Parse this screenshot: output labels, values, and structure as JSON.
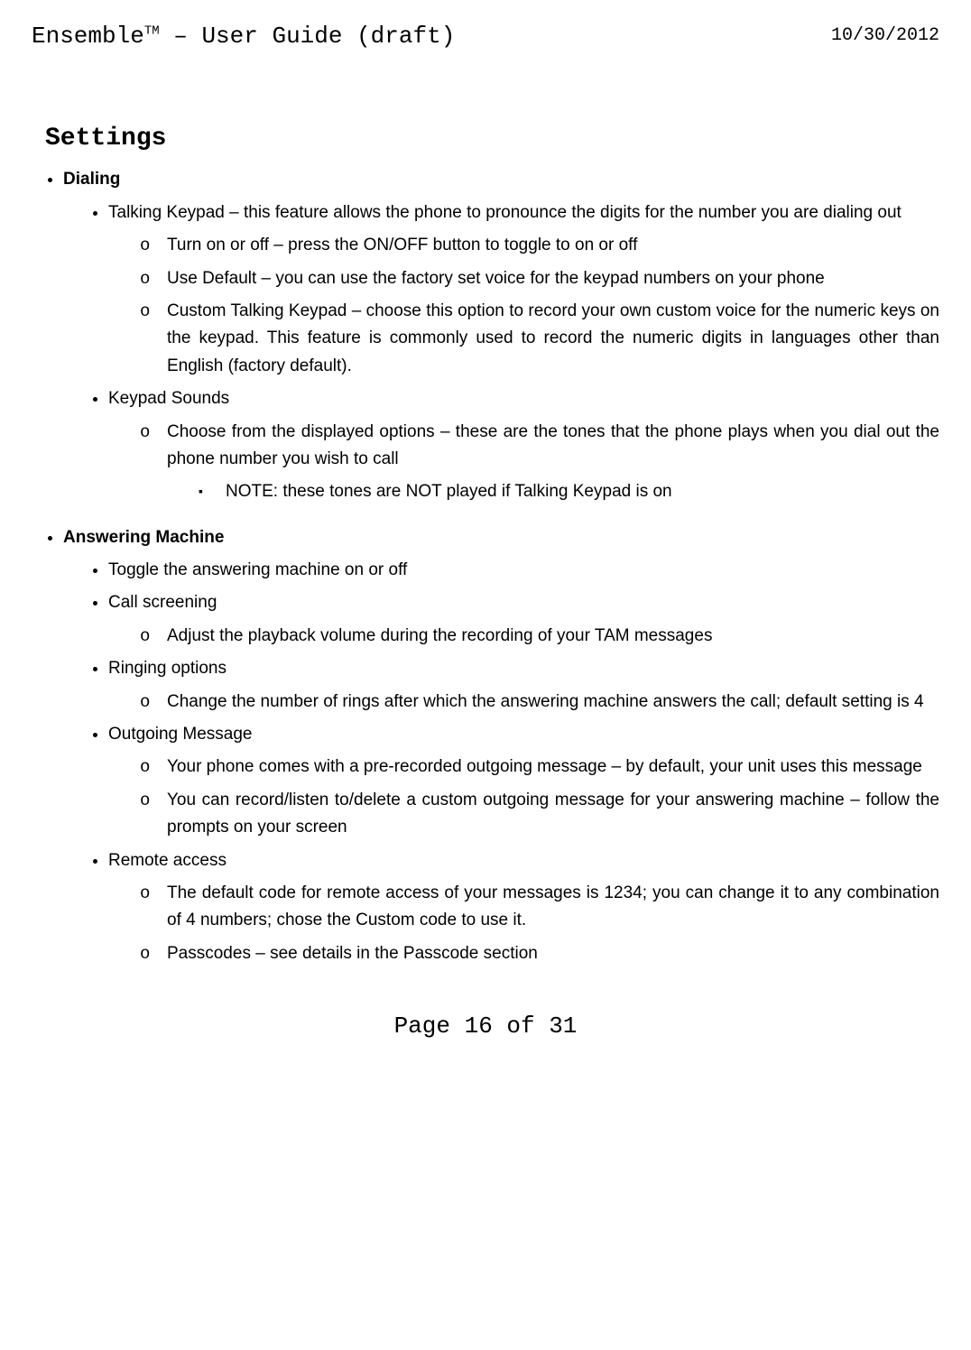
{
  "header": {
    "title_pre": "Ensemble",
    "tm": "TM",
    "title_post": " – User Guide (draft)",
    "date": "10/30/2012"
  },
  "title": "Settings",
  "sections": [
    {
      "head": "Dialing",
      "items": [
        {
          "text": "Talking Keypad – this feature allows the phone to pronounce the digits for the number you are dialing out",
          "sub": [
            "Turn on or off – press the ON/OFF button to toggle to on or off",
            "Use Default – you can use the factory set voice for the keypad numbers on your phone",
            "Custom Talking Keypad – choose this option to record your own custom voice for the numeric keys on the keypad.  This feature is commonly used to record the numeric digits in languages other than English (factory default)."
          ]
        },
        {
          "text": "Keypad Sounds",
          "sub": [
            {
              "text": "Choose from the displayed options – these are the tones that the phone plays when you dial out the phone number you wish to call",
              "subsub": [
                "NOTE: these tones are NOT played if Talking Keypad is on"
              ]
            }
          ]
        }
      ]
    },
    {
      "head": "Answering Machine",
      "items": [
        {
          "text": "Toggle the answering machine on or off"
        },
        {
          "text": "Call screening",
          "sub": [
            "Adjust the playback volume during the recording of your TAM messages"
          ]
        },
        {
          "text": "Ringing options",
          "sub": [
            "Change the number of rings after which the answering machine answers the call; default setting is 4"
          ]
        },
        {
          "text": "Outgoing Message",
          "sub": [
            "Your phone comes with a pre-recorded outgoing message – by default, your unit uses this message",
            "You can record/listen to/delete a custom outgoing message for your answering machine – follow the prompts on your screen"
          ]
        },
        {
          "text": "Remote access",
          "sub": [
            "The default code for remote access of your messages is 1234; you can change it to any combination of 4 numbers; chose the Custom code to use it.",
            "Passcodes – see details in the Passcode section"
          ]
        }
      ]
    }
  ],
  "footer": "Page 16 of 31"
}
